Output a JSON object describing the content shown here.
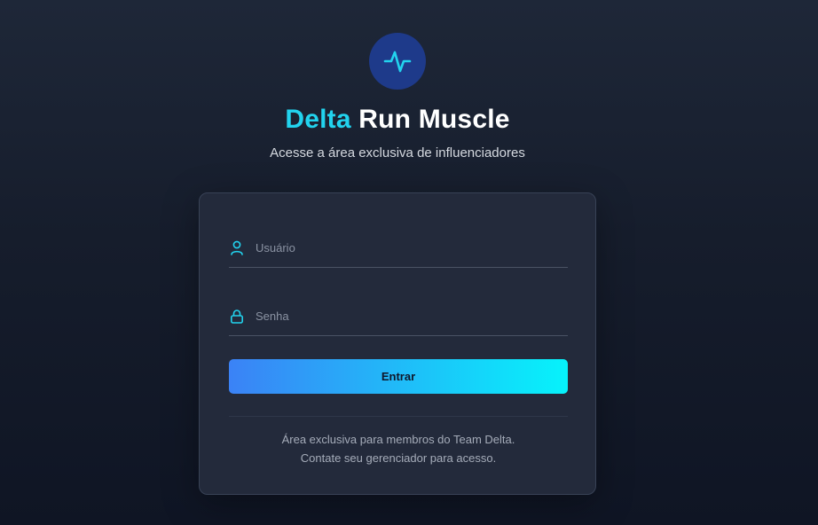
{
  "brand": {
    "logo_icon": "pulse-icon",
    "title_accent": "Delta",
    "title_rest": "Run Muscle",
    "subtitle": "Acesse a área exclusiva de influenciadores",
    "accent_color": "#22d3ee"
  },
  "form": {
    "username": {
      "placeholder": "Usuário",
      "value": "",
      "icon": "user-icon"
    },
    "password": {
      "placeholder": "Senha",
      "value": "",
      "icon": "lock-icon"
    },
    "submit_label": "Entrar"
  },
  "footer": {
    "line1": "Área exclusiva para membros do Team Delta.",
    "line2": "Contate seu gerenciador para acesso."
  }
}
